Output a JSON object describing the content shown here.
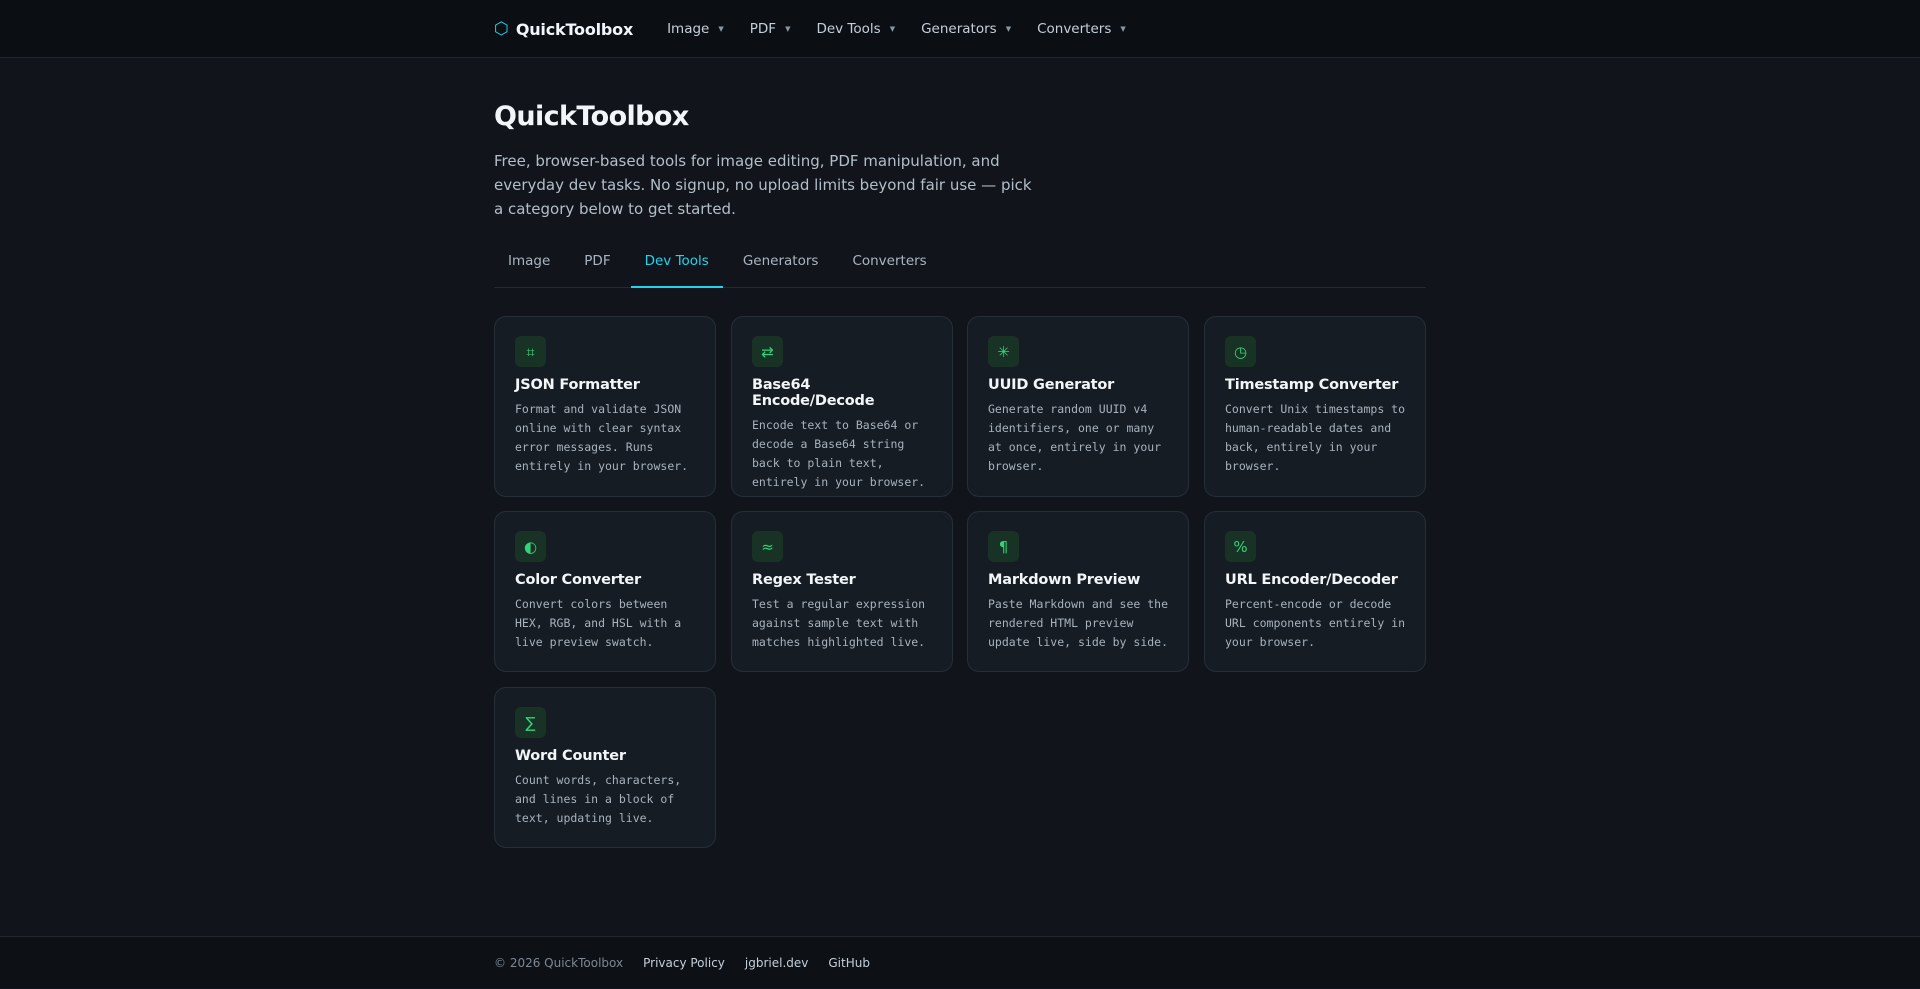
{
  "brand": {
    "name": "QuickToolbox",
    "icon": "hexagon-icon",
    "accent": "#22d3ee"
  },
  "nav": [
    {
      "label": "Image"
    },
    {
      "label": "PDF"
    },
    {
      "label": "Dev Tools"
    },
    {
      "label": "Generators"
    },
    {
      "label": "Converters"
    }
  ],
  "hero": {
    "title": "QuickToolbox",
    "description": "Free, browser-based tools for image editing, PDF manipulation, and everyday dev tasks. No signup, no upload limits beyond fair use — pick a category below to get started."
  },
  "tabs": {
    "items": [
      {
        "label": "Image"
      },
      {
        "label": "PDF"
      },
      {
        "label": "Dev Tools"
      },
      {
        "label": "Generators"
      },
      {
        "label": "Converters"
      }
    ],
    "active": "Dev Tools"
  },
  "tools": [
    {
      "icon": "crop-icon",
      "glyph": "⌗",
      "title": "JSON Formatter",
      "desc": "Format and validate JSON online with clear syntax error messages. Runs entirely in your browser."
    },
    {
      "icon": "swap-arrows-icon",
      "glyph": "⇄",
      "title": "Base64 Encode/Decode",
      "desc": "Encode text to Base64 or decode a Base64 string back to plain text, entirely in your browser."
    },
    {
      "icon": "asterisk-icon",
      "glyph": "✳",
      "title": "UUID Generator",
      "desc": "Generate random UUID v4 identifiers, one or many at once, entirely in your browser."
    },
    {
      "icon": "clock-icon",
      "glyph": "◷",
      "title": "Timestamp Converter",
      "desc": "Convert Unix timestamps to human-readable dates and back, entirely in your browser."
    },
    {
      "icon": "half-circle-icon",
      "glyph": "◐",
      "title": "Color Converter",
      "desc": "Convert colors between HEX, RGB, and HSL with a live preview swatch."
    },
    {
      "icon": "approx-icon",
      "glyph": "≈",
      "title": "Regex Tester",
      "desc": "Test a regular expression against sample text with matches highlighted live."
    },
    {
      "icon": "pilcrow-icon",
      "glyph": "¶",
      "title": "Markdown Preview",
      "desc": "Paste Markdown and see the rendered HTML preview update live, side by side."
    },
    {
      "icon": "percent-icon",
      "glyph": "%",
      "title": "URL Encoder/Decoder",
      "desc": "Percent-encode or decode URL components entirely in your browser."
    },
    {
      "icon": "sigma-icon",
      "glyph": "∑",
      "title": "Word Counter",
      "desc": "Count words, characters, and lines in a block of text, updating live."
    }
  ],
  "footer": {
    "copyright": "© 2026 QuickToolbox",
    "links": [
      {
        "label": "Privacy Policy"
      },
      {
        "label": "jgbriel.dev"
      },
      {
        "label": "GitHub"
      }
    ]
  }
}
